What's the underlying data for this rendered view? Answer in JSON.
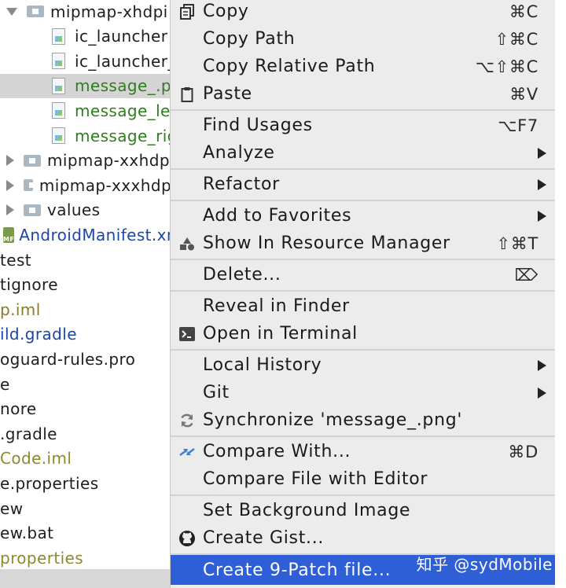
{
  "tree": [
    {
      "label": "mipmap-xhdpi",
      "kind": "folder",
      "expanded": true,
      "indent": 8,
      "color": "dark"
    },
    {
      "label": "ic_launcher",
      "kind": "png",
      "indent": 66,
      "color": "dark"
    },
    {
      "label": "ic_launcher_",
      "kind": "png",
      "indent": 66,
      "color": "dark"
    },
    {
      "label": "message_.p",
      "kind": "png",
      "indent": 66,
      "color": "green",
      "selected": true
    },
    {
      "label": "message_le",
      "kind": "png",
      "indent": 66,
      "color": "green"
    },
    {
      "label": "message_rig",
      "kind": "png",
      "indent": 66,
      "color": "green"
    },
    {
      "label": "mipmap-xxhdpi",
      "kind": "folder",
      "indent": 8,
      "color": "dark"
    },
    {
      "label": "mipmap-xxxhdpi",
      "kind": "folder",
      "indent": 8,
      "color": "dark"
    },
    {
      "label": "values",
      "kind": "folder",
      "indent": 8,
      "color": "dark"
    },
    {
      "label": "AndroidManifest.xml",
      "kind": "manifest",
      "indent": 4,
      "color": "blue"
    },
    {
      "label": "test",
      "kind": "none",
      "indent": 0,
      "color": "dark"
    },
    {
      "label": "tignore",
      "kind": "none",
      "indent": 0,
      "color": "dark"
    },
    {
      "label": "p.iml",
      "kind": "none",
      "indent": 0,
      "color": "olive"
    },
    {
      "label": "ild.gradle",
      "kind": "none",
      "indent": 0,
      "color": "blue"
    },
    {
      "label": "oguard-rules.pro",
      "kind": "none",
      "indent": 0,
      "color": "dark"
    },
    {
      "label": "e",
      "kind": "none",
      "indent": 0,
      "color": "dark"
    },
    {
      "label": "nore",
      "kind": "none",
      "indent": 0,
      "color": "dark"
    },
    {
      "label": ".gradle",
      "kind": "none",
      "indent": 0,
      "color": "dark"
    },
    {
      "label": "Code.iml",
      "kind": "none",
      "indent": 0,
      "color": "olive2"
    },
    {
      "label": "e.properties",
      "kind": "none",
      "indent": 0,
      "color": "dark"
    },
    {
      "label": "ew",
      "kind": "none",
      "indent": 0,
      "color": "dark"
    },
    {
      "label": "ew.bat",
      "kind": "none",
      "indent": 0,
      "color": "dark"
    },
    {
      "label": "properties",
      "kind": "none",
      "indent": 0,
      "color": "olive2"
    }
  ],
  "menu": {
    "copy": {
      "label": "Copy",
      "shortcut": "⌘C"
    },
    "copy_path": {
      "label": "Copy Path",
      "shortcut": "⇧⌘C"
    },
    "copy_relative_path": {
      "label": "Copy Relative Path",
      "shortcut": "⌥⇧⌘C"
    },
    "paste": {
      "label": "Paste",
      "shortcut": "⌘V"
    },
    "find_usages": {
      "label": "Find Usages",
      "shortcut": "⌥F7"
    },
    "analyze": {
      "label": "Analyze"
    },
    "refactor": {
      "label": "Refactor"
    },
    "add_to_favorites": {
      "label": "Add to Favorites"
    },
    "show_in_resource_manager": {
      "label": "Show In Resource Manager",
      "shortcut": "⇧⌘T"
    },
    "delete": {
      "label": "Delete...",
      "shortcut": "⌦"
    },
    "reveal_in_finder": {
      "label": "Reveal in Finder"
    },
    "open_in_terminal": {
      "label": "Open in Terminal"
    },
    "local_history": {
      "label": "Local History"
    },
    "git": {
      "label": "Git"
    },
    "synchronize": {
      "label": "Synchronize 'message_.png'"
    },
    "compare_with": {
      "label": "Compare With...",
      "shortcut": "⌘D"
    },
    "compare_file_with_editor": {
      "label": "Compare File with Editor"
    },
    "set_background_image": {
      "label": "Set Background Image"
    },
    "create_gist": {
      "label": "Create Gist..."
    },
    "create_9patch": {
      "label": "Create 9-Patch file..."
    }
  },
  "watermark": "知乎 @sydMobile",
  "colors": {
    "menu_bg": "#ececec",
    "highlight": "#2f5fd6",
    "green_file": "#2e7d1e",
    "blue_file": "#1b47a8"
  }
}
